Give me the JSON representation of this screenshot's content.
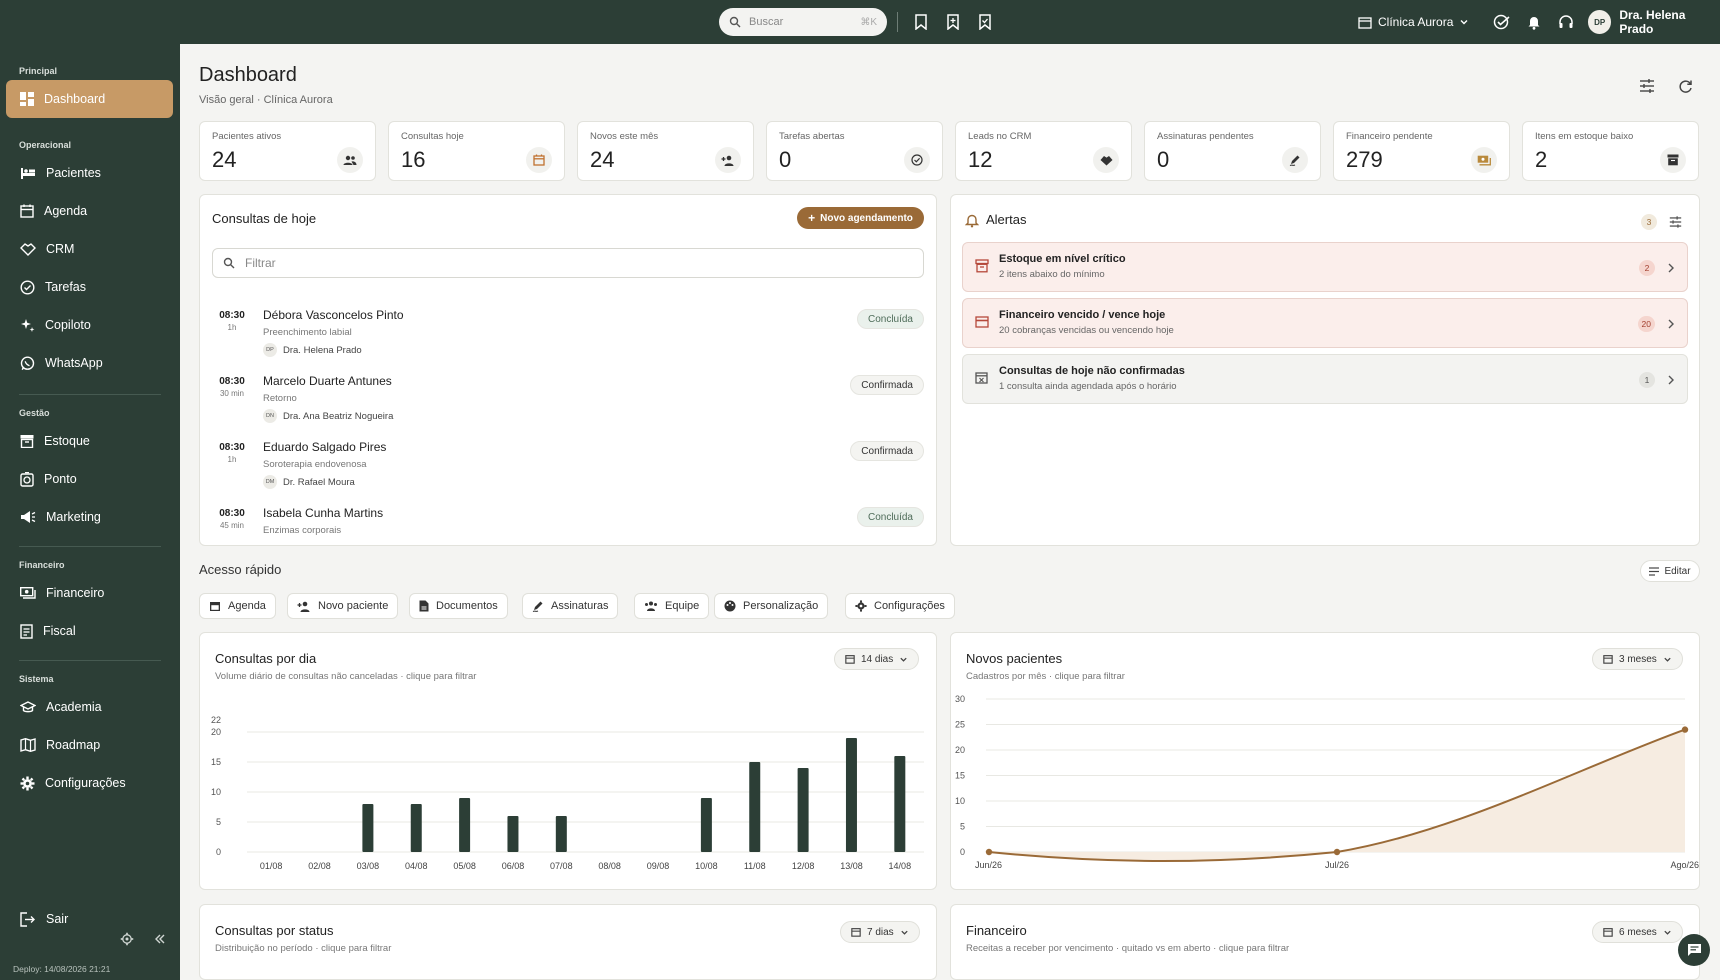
{
  "topbar": {
    "search_placeholder": "Buscar",
    "search_shortcut": "⌘K",
    "clinic": "Clínica Aurora",
    "user_initials": "DP",
    "user_name": "Dra. Helena Prado"
  },
  "sidebar": {
    "sections": {
      "principal": "Principal",
      "operacional": "Operacional",
      "gestao": "Gestão",
      "financeiro": "Financeiro",
      "sistema": "Sistema"
    },
    "items": {
      "dashboard": "Dashboard",
      "pacientes": "Pacientes",
      "agenda": "Agenda",
      "crm": "CRM",
      "tarefas": "Tarefas",
      "copiloto": "Copiloto",
      "whatsapp": "WhatsApp",
      "estoque": "Estoque",
      "ponto": "Ponto",
      "marketing": "Marketing",
      "financeiro": "Financeiro",
      "fiscal": "Fiscal",
      "academia": "Academia",
      "roadmap": "Roadmap",
      "configuracoes": "Configurações"
    },
    "logout": "Sair",
    "deploy": "Deploy: 14/08/2026 21:21"
  },
  "header": {
    "title": "Dashboard",
    "subtitle": "Visão geral · Clínica Aurora"
  },
  "stats": [
    {
      "label": "Pacientes ativos",
      "value": "24"
    },
    {
      "label": "Consultas hoje",
      "value": "16"
    },
    {
      "label": "Novos este mês",
      "value": "24"
    },
    {
      "label": "Tarefas abertas",
      "value": "0"
    },
    {
      "label": "Leads no CRM",
      "value": "12"
    },
    {
      "label": "Assinaturas pendentes",
      "value": "0"
    },
    {
      "label": "Financeiro pendente",
      "value": "279"
    },
    {
      "label": "Itens em estoque baixo",
      "value": "2"
    }
  ],
  "appointments": {
    "title": "Consultas de hoje",
    "new_button": "Novo agendamento",
    "filter_placeholder": "Filtrar",
    "items": [
      {
        "time": "08:30",
        "duration": "1h",
        "patient": "Débora Vasconcelos Pinto",
        "procedure": "Preenchimento labial",
        "doctor_initials": "DP",
        "doctor": "Dra. Helena Prado",
        "status": "Concluída",
        "status_kind": "done"
      },
      {
        "time": "08:30",
        "duration": "30 min",
        "patient": "Marcelo Duarte Antunes",
        "procedure": "Retorno",
        "doctor_initials": "DN",
        "doctor": "Dra. Ana Beatriz Nogueira",
        "status": "Confirmada",
        "status_kind": "conf"
      },
      {
        "time": "08:30",
        "duration": "1h",
        "patient": "Eduardo Salgado Pires",
        "procedure": "Soroterapia endovenosa",
        "doctor_initials": "DM",
        "doctor": "Dr. Rafael Moura",
        "status": "Confirmada",
        "status_kind": "conf"
      },
      {
        "time": "08:30",
        "duration": "45 min",
        "patient": "Isabela Cunha Martins",
        "procedure": "Enzimas corporais",
        "doctor_initials": "",
        "doctor": "",
        "status": "Concluída",
        "status_kind": "done"
      }
    ]
  },
  "alerts": {
    "title": "Alertas",
    "count": "3",
    "items": [
      {
        "title": "Estoque em nível crítico",
        "subtitle": "2 itens abaixo do mínimo",
        "count": "2",
        "kind": "red"
      },
      {
        "title": "Financeiro vencido / vence hoje",
        "subtitle": "20 cobranças vencidas ou vencendo hoje",
        "count": "20",
        "kind": "red"
      },
      {
        "title": "Consultas de hoje não confirmadas",
        "subtitle": "1 consulta ainda agendada após o horário",
        "count": "1",
        "kind": "gray"
      }
    ]
  },
  "quick_access": {
    "title": "Acesso rápido",
    "edit": "Editar",
    "chips": [
      "Agenda",
      "Novo paciente",
      "Documentos",
      "Assinaturas",
      "Equipe",
      "Personalização",
      "Configurações"
    ]
  },
  "panels": {
    "consultas_dia": {
      "title": "Consultas por dia",
      "subtitle": "Volume diário de consultas não canceladas · clique para filtrar",
      "range": "14 dias"
    },
    "novos_pacientes": {
      "title": "Novos pacientes",
      "subtitle": "Cadastros por mês · clique para filtrar",
      "range": "3 meses"
    },
    "consultas_status": {
      "title": "Consultas por status",
      "subtitle": "Distribuição no período · clique para filtrar",
      "range": "7 dias"
    },
    "financeiro": {
      "title": "Financeiro",
      "subtitle": "Receitas a receber por vencimento · quitado vs em aberto · clique para filtrar",
      "range": "6 meses"
    }
  },
  "colors": {
    "sidebar": "#2c3e36",
    "accent": "#c79a66",
    "bar": "#2c3e36",
    "line": "#9a6a37"
  },
  "chart_data": [
    {
      "type": "bar",
      "title": "Consultas por dia",
      "categories": [
        "01/08",
        "02/08",
        "03/08",
        "04/08",
        "05/08",
        "06/08",
        "07/08",
        "08/08",
        "09/08",
        "10/08",
        "11/08",
        "12/08",
        "13/08",
        "14/08"
      ],
      "values": [
        0,
        0,
        8,
        8,
        9,
        6,
        6,
        0,
        0,
        9,
        15,
        14,
        19,
        16
      ],
      "yticks": [
        0,
        5,
        10,
        15,
        20,
        22
      ],
      "ylim": [
        0,
        22
      ],
      "grid": true
    },
    {
      "type": "area",
      "title": "Novos pacientes",
      "categories": [
        "Jun/26",
        "Jul/26",
        "Ago/26"
      ],
      "values": [
        0,
        0,
        24
      ],
      "yticks": [
        0,
        5,
        10,
        15,
        20,
        25,
        30
      ],
      "ylim": [
        0,
        30
      ],
      "grid": true
    }
  ]
}
